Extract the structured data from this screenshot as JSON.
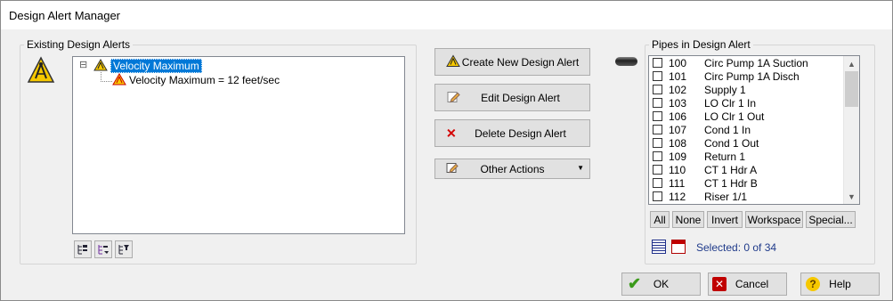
{
  "window": {
    "title": "Design Alert Manager"
  },
  "existing_alerts": {
    "label": "Existing Design Alerts",
    "tree": {
      "expander": "⊟",
      "root_label": "Velocity Maximum",
      "child_label": "Velocity Maximum = 12 feet/sec"
    }
  },
  "actions": {
    "create": "Create New Design Alert",
    "edit": "Edit Design Alert",
    "delete": "Delete Design Alert",
    "other": "Other Actions"
  },
  "pipes": {
    "label": "Pipes in Design Alert",
    "rows": [
      {
        "num": "100",
        "name": "Circ Pump 1A Suction"
      },
      {
        "num": "101",
        "name": "Circ Pump 1A Disch"
      },
      {
        "num": "102",
        "name": "Supply 1"
      },
      {
        "num": "103",
        "name": "LO Clr 1 In"
      },
      {
        "num": "106",
        "name": "LO Clr 1 Out"
      },
      {
        "num": "107",
        "name": "Cond 1 In"
      },
      {
        "num": "108",
        "name": "Cond 1 Out"
      },
      {
        "num": "109",
        "name": "Return 1"
      },
      {
        "num": "110",
        "name": "CT 1 Hdr A"
      },
      {
        "num": "111",
        "name": "CT 1 Hdr B"
      },
      {
        "num": "112",
        "name": "Riser 1/1"
      }
    ],
    "buttons": {
      "all": "All",
      "none": "None",
      "invert": "Invert",
      "workspace": "Workspace",
      "special": "Special..."
    },
    "selected_text": "Selected: 0 of 34"
  },
  "footer": {
    "ok": "OK",
    "cancel": "Cancel",
    "help": "Help"
  },
  "colors": {
    "accent": "#0078d7",
    "selected_text": "#1f3a8a",
    "warning": "#f2c200"
  }
}
